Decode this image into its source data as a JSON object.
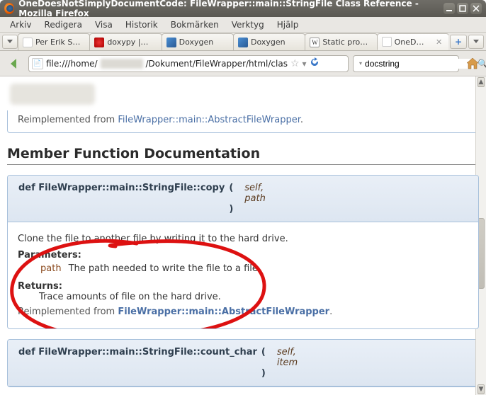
{
  "window": {
    "title": "OneDoesNotSimplyDocumentCode: FileWrapper::main::StringFile Class Reference - Mozilla Firefox"
  },
  "menubar": [
    "Arkiv",
    "Redigera",
    "Visa",
    "Historik",
    "Bokmärken",
    "Verktyg",
    "Hjälp"
  ],
  "tabs": [
    {
      "label": "Per Erik S…",
      "favicon": "generic"
    },
    {
      "label": "doxypy |…",
      "favicon": "red"
    },
    {
      "label": "Doxygen",
      "favicon": "doxy"
    },
    {
      "label": "Doxygen",
      "favicon": "doxy"
    },
    {
      "label": "Static pro…",
      "favicon": "wiki"
    },
    {
      "label": "OneD…",
      "favicon": "generic",
      "active": true
    }
  ],
  "url": {
    "prefix": "file:///home/",
    "suffix": "/Dokument/FileWrapper/html/clas"
  },
  "search": {
    "value": "docstring"
  },
  "reimpl_top": {
    "prefix": "Reimplemented from ",
    "link": "FileWrapper::main::AbstractFileWrapper"
  },
  "section_heading": "Member Function Documentation",
  "func1": {
    "sig_prefix": "def FileWrapper::main::StringFile::copy",
    "params": [
      "self",
      "path"
    ],
    "desc": "Clone the file to another file by writing it to the hard drive.",
    "param_hdr": "Parameters:",
    "param_rows": [
      {
        "name": "path",
        "desc": "The path needed to write the file to a file."
      }
    ],
    "ret_hdr": "Returns:",
    "ret_val": "Trace amounts of file on the hard drive.",
    "reimpl": {
      "prefix": "Reimplemented from ",
      "link": "FileWrapper::main::AbstractFileWrapper"
    }
  },
  "func2": {
    "sig_prefix": "def FileWrapper::main::StringFile::count_char",
    "params": [
      "self",
      "item"
    ]
  }
}
